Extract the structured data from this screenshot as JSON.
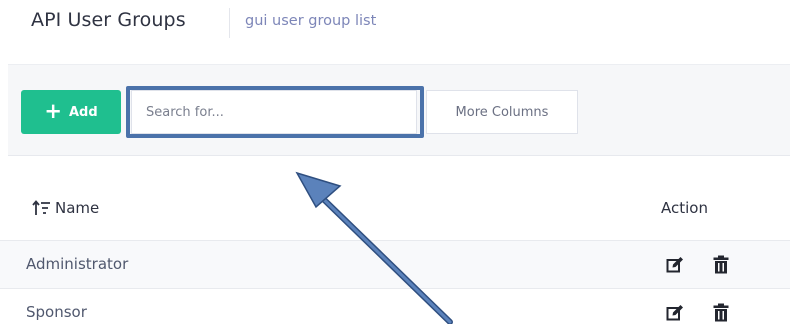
{
  "header": {
    "title": "API User Groups",
    "subtitle": "gui user group list"
  },
  "toolbar": {
    "add_label": "Add",
    "search_placeholder": "Search for...",
    "more_columns_label": "More Columns"
  },
  "table": {
    "columns": {
      "name": "Name",
      "action": "Action"
    },
    "rows": [
      {
        "name": "Administrator"
      },
      {
        "name": "Sponsor"
      }
    ]
  },
  "annotation": {
    "highlight_color": "#4b72aa",
    "arrow_color": "#4b72aa",
    "highlight_target": "search-input"
  },
  "colors": {
    "accent": "#1fbf8f",
    "subtitle": "#7d86b8"
  },
  "icons": {
    "add": "plus-icon",
    "sort": "sort-icon",
    "edit": "edit-icon",
    "delete": "trash-icon"
  }
}
